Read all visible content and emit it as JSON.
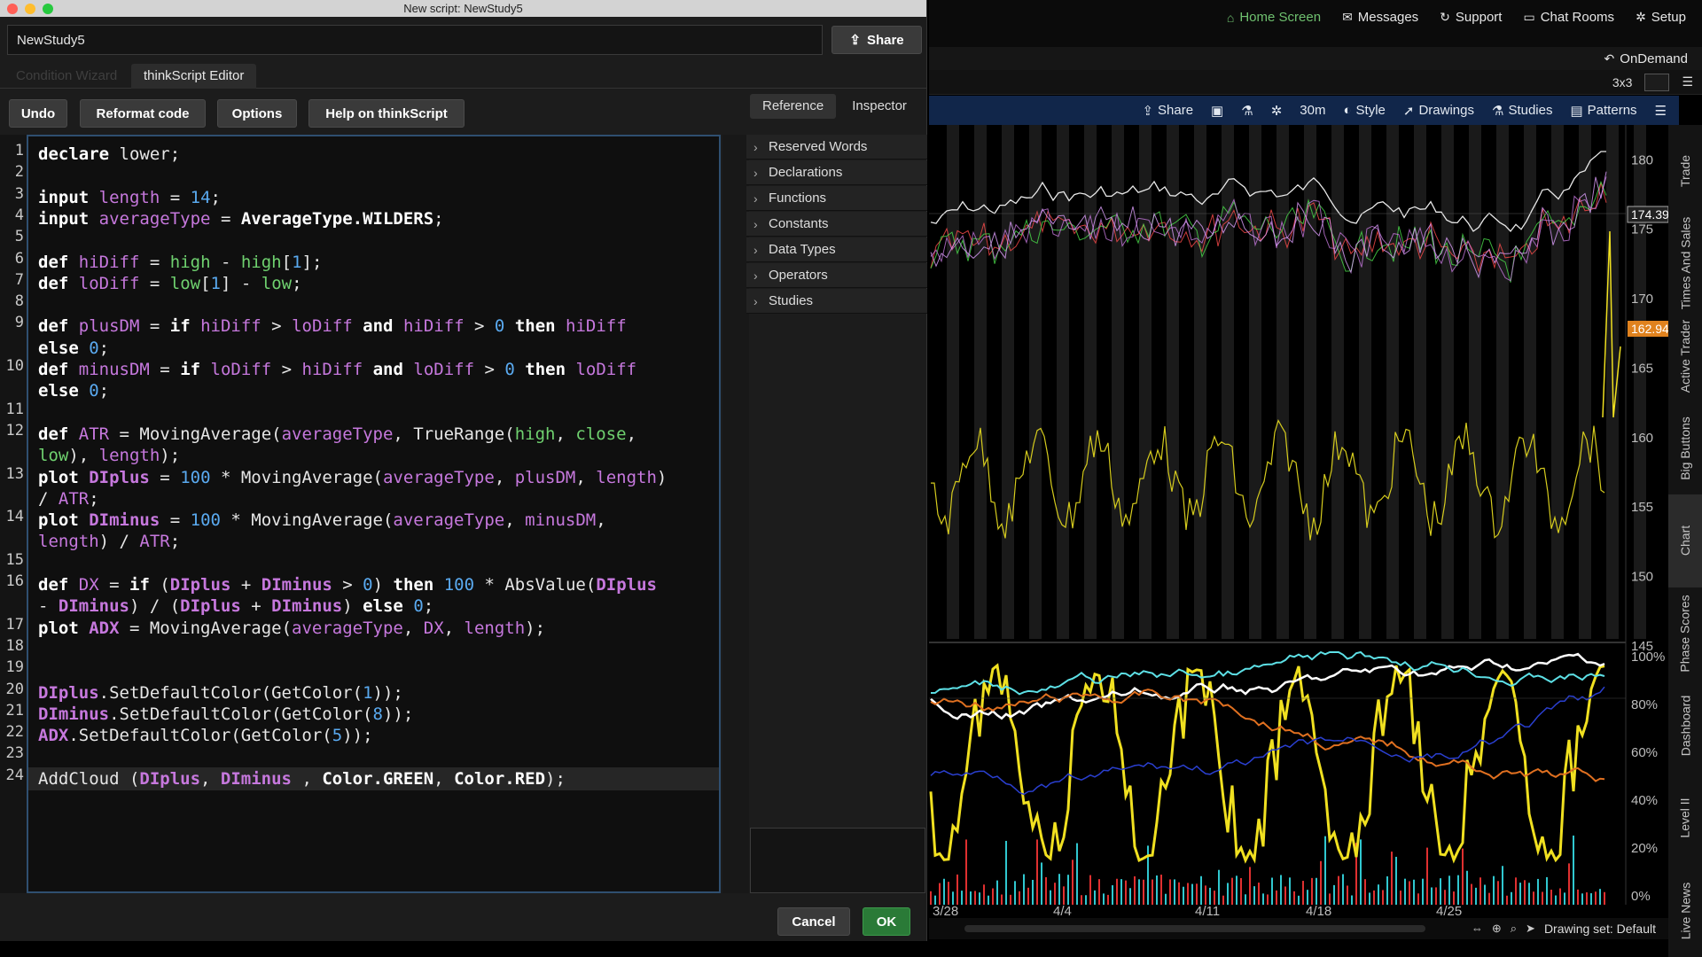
{
  "window_title": "New script: NewStudy5",
  "script_name": "NewStudy5",
  "share_label": "Share",
  "tabs": [
    "Condition Wizard",
    "thinkScript Editor"
  ],
  "buttons": {
    "undo": "Undo",
    "reformat": "Reformat code",
    "options": "Options",
    "help": "Help on thinkScript"
  },
  "ref_tabs": [
    "Reference",
    "Inspector"
  ],
  "reference_items": [
    "Reserved Words",
    "Declarations",
    "Functions",
    "Constants",
    "Data Types",
    "Operators",
    "Studies"
  ],
  "dialog_buttons": {
    "cancel": "Cancel",
    "ok": "OK"
  },
  "code_lines": [
    [
      [
        [
          "kw",
          "declare"
        ],
        [
          "fn",
          " lower;"
        ]
      ]
    ],
    [],
    [
      [
        [
          "kw",
          "input"
        ],
        [
          "fn",
          " "
        ],
        [
          "vr",
          "length"
        ],
        [
          "fn",
          " = "
        ],
        [
          "nm",
          "14"
        ],
        [
          "fn",
          ";"
        ]
      ]
    ],
    [
      [
        [
          "kw",
          "input"
        ],
        [
          "fn",
          " "
        ],
        [
          "vr",
          "averageType"
        ],
        [
          "fn",
          " = "
        ],
        [
          "kw",
          "AverageType.WILDERS"
        ],
        [
          "fn",
          ";"
        ]
      ]
    ],
    [],
    [
      [
        [
          "kw",
          "def"
        ],
        [
          "fn",
          " "
        ],
        [
          "vr",
          "hiDiff"
        ],
        [
          "fn",
          " = "
        ],
        [
          "gr",
          "high"
        ],
        [
          "fn",
          " - "
        ],
        [
          "gr",
          "high"
        ],
        [
          "fn",
          "["
        ],
        [
          "nm",
          "1"
        ],
        [
          "fn",
          "];"
        ]
      ]
    ],
    [
      [
        [
          "kw",
          "def"
        ],
        [
          "fn",
          " "
        ],
        [
          "vr",
          "loDiff"
        ],
        [
          "fn",
          " = "
        ],
        [
          "gr",
          "low"
        ],
        [
          "fn",
          "["
        ],
        [
          "nm",
          "1"
        ],
        [
          "fn",
          "] - "
        ],
        [
          "gr",
          "low"
        ],
        [
          "fn",
          ";"
        ]
      ]
    ],
    [],
    [
      [
        [
          "kw",
          "def"
        ],
        [
          "fn",
          " "
        ],
        [
          "vr",
          "plusDM"
        ],
        [
          "fn",
          " = "
        ],
        [
          "kw",
          "if"
        ],
        [
          "fn",
          " "
        ],
        [
          "vr",
          "hiDiff"
        ],
        [
          "fn",
          " > "
        ],
        [
          "vr",
          "loDiff"
        ],
        [
          "fn",
          " "
        ],
        [
          "kw",
          "and"
        ],
        [
          "fn",
          " "
        ],
        [
          "vr",
          "hiDiff"
        ],
        [
          "fn",
          " > "
        ],
        [
          "nm",
          "0"
        ],
        [
          "fn",
          " "
        ],
        [
          "kw",
          "then"
        ],
        [
          "fn",
          " "
        ],
        [
          "vr",
          "hiDiff"
        ]
      ],
      [
        [
          "kw",
          "else"
        ],
        [
          "fn",
          " "
        ],
        [
          "nm",
          "0"
        ],
        [
          "fn",
          ";"
        ]
      ]
    ],
    [
      [
        [
          "kw",
          "def"
        ],
        [
          "fn",
          " "
        ],
        [
          "vr",
          "minusDM"
        ],
        [
          "fn",
          " = "
        ],
        [
          "kw",
          "if"
        ],
        [
          "fn",
          " "
        ],
        [
          "vr",
          "loDiff"
        ],
        [
          "fn",
          " > "
        ],
        [
          "vr",
          "hiDiff"
        ],
        [
          "fn",
          " "
        ],
        [
          "kw",
          "and"
        ],
        [
          "fn",
          " "
        ],
        [
          "vr",
          "loDiff"
        ],
        [
          "fn",
          " > "
        ],
        [
          "nm",
          "0"
        ],
        [
          "fn",
          " "
        ],
        [
          "kw",
          "then"
        ],
        [
          "fn",
          " "
        ],
        [
          "vr",
          "loDiff"
        ]
      ],
      [
        [
          "kw",
          "else"
        ],
        [
          "fn",
          " "
        ],
        [
          "nm",
          "0"
        ],
        [
          "fn",
          ";"
        ]
      ]
    ],
    [],
    [
      [
        [
          "kw",
          "def"
        ],
        [
          "fn",
          " "
        ],
        [
          "vr",
          "ATR"
        ],
        [
          "fn",
          " = MovingAverage("
        ],
        [
          "vr",
          "averageType"
        ],
        [
          "fn",
          ", TrueRange("
        ],
        [
          "gr",
          "high"
        ],
        [
          "fn",
          ", "
        ],
        [
          "gr",
          "close"
        ],
        [
          "fn",
          ","
        ]
      ],
      [
        [
          "gr",
          "low"
        ],
        [
          "fn",
          "), "
        ],
        [
          "vr",
          "length"
        ],
        [
          "fn",
          ");"
        ]
      ]
    ],
    [
      [
        [
          "kw",
          "plot"
        ],
        [
          "fn",
          " "
        ],
        [
          "vb",
          "DIplus"
        ],
        [
          "fn",
          " = "
        ],
        [
          "nm",
          "100"
        ],
        [
          "fn",
          " * MovingAverage("
        ],
        [
          "vr",
          "averageType"
        ],
        [
          "fn",
          ", "
        ],
        [
          "vr",
          "plusDM"
        ],
        [
          "fn",
          ", "
        ],
        [
          "vr",
          "length"
        ],
        [
          "fn",
          ")"
        ]
      ],
      [
        [
          "fn",
          "/ "
        ],
        [
          "vr",
          "ATR"
        ],
        [
          "fn",
          ";"
        ]
      ]
    ],
    [
      [
        [
          "kw",
          "plot"
        ],
        [
          "fn",
          " "
        ],
        [
          "vb",
          "DIminus"
        ],
        [
          "fn",
          " = "
        ],
        [
          "nm",
          "100"
        ],
        [
          "fn",
          " * MovingAverage("
        ],
        [
          "vr",
          "averageType"
        ],
        [
          "fn",
          ", "
        ],
        [
          "vr",
          "minusDM"
        ],
        [
          "fn",
          ","
        ]
      ],
      [
        [
          "vr",
          "length"
        ],
        [
          "fn",
          ") / "
        ],
        [
          "vr",
          "ATR"
        ],
        [
          "fn",
          ";"
        ]
      ]
    ],
    [],
    [
      [
        [
          "kw",
          "def"
        ],
        [
          "fn",
          " "
        ],
        [
          "vr",
          "DX"
        ],
        [
          "fn",
          " = "
        ],
        [
          "kw",
          "if"
        ],
        [
          "fn",
          " ("
        ],
        [
          "vb",
          "DIplus"
        ],
        [
          "fn",
          " + "
        ],
        [
          "vb",
          "DIminus"
        ],
        [
          "fn",
          " > "
        ],
        [
          "nm",
          "0"
        ],
        [
          "fn",
          ") "
        ],
        [
          "kw",
          "then"
        ],
        [
          "fn",
          " "
        ],
        [
          "nm",
          "100"
        ],
        [
          "fn",
          " * AbsValue("
        ],
        [
          "vb",
          "DIplus"
        ]
      ],
      [
        [
          "fn",
          "- "
        ],
        [
          "vb",
          "DIminus"
        ],
        [
          "fn",
          ") / ("
        ],
        [
          "vb",
          "DIplus"
        ],
        [
          "fn",
          " + "
        ],
        [
          "vb",
          "DIminus"
        ],
        [
          "fn",
          ") "
        ],
        [
          "kw",
          "else"
        ],
        [
          "fn",
          " "
        ],
        [
          "nm",
          "0"
        ],
        [
          "fn",
          ";"
        ]
      ]
    ],
    [
      [
        [
          "kw",
          "plot"
        ],
        [
          "fn",
          " "
        ],
        [
          "vb",
          "ADX"
        ],
        [
          "fn",
          " = MovingAverage("
        ],
        [
          "vr",
          "averageType"
        ],
        [
          "fn",
          ", "
        ],
        [
          "vr",
          "DX"
        ],
        [
          "fn",
          ", "
        ],
        [
          "vr",
          "length"
        ],
        [
          "fn",
          ");"
        ]
      ]
    ],
    [],
    [],
    [
      [
        [
          "vb",
          "DIplus"
        ],
        [
          "fn",
          ".SetDefaultColor(GetColor("
        ],
        [
          "nm",
          "1"
        ],
        [
          "fn",
          "));"
        ]
      ]
    ],
    [
      [
        [
          "vb",
          "DIminus"
        ],
        [
          "fn",
          ".SetDefaultColor(GetColor("
        ],
        [
          "nm",
          "8"
        ],
        [
          "fn",
          "));"
        ]
      ]
    ],
    [
      [
        [
          "vb",
          "ADX"
        ],
        [
          "fn",
          ".SetDefaultColor(GetColor("
        ],
        [
          "nm",
          "5"
        ],
        [
          "fn",
          "));"
        ]
      ]
    ],
    [],
    [
      [
        [
          "fn",
          "AddCloud ("
        ],
        [
          "vb",
          "DIplus"
        ],
        [
          "fn",
          ", "
        ],
        [
          "vb",
          "DIminus"
        ],
        [
          "fn",
          " , "
        ],
        [
          "kw",
          "Color.GREEN"
        ],
        [
          "fn",
          ", "
        ],
        [
          "kw",
          "Color.RED"
        ],
        [
          "fn",
          ");"
        ]
      ]
    ]
  ],
  "top_nav": [
    {
      "icon": "home-icon",
      "label": "Home Screen"
    },
    {
      "icon": "mail-icon",
      "label": "Messages"
    },
    {
      "icon": "support-icon",
      "label": "Support"
    },
    {
      "icon": "chat-icon",
      "label": "Chat Rooms"
    },
    {
      "icon": "gear-icon",
      "label": "Setup"
    }
  ],
  "ondemand_label": "OnDemand",
  "grid_label": "3x3",
  "chart_toolbar": {
    "share": "Share",
    "timeframe": "30m",
    "style": "Style",
    "drawings": "Drawings",
    "studies": "Studies",
    "patterns": "Patterns"
  },
  "side_tabs": [
    "Trade",
    "Times And Sales",
    "Active Trader",
    "Big Buttons",
    "Chart",
    "Phase Scores",
    "Dashboard",
    "Level II",
    "Live News"
  ],
  "status": {
    "drawing_set": "Drawing set: Default"
  },
  "colors": {
    "ok_green": "#2a7a37",
    "toolbar_blue": "#11264a",
    "price_tag": "#e0821e",
    "editor_border": "#2f4f70"
  },
  "chart_data": [
    {
      "type": "line",
      "panel": "price",
      "ytick_labels": [
        "180",
        "175",
        "170",
        "165",
        "160",
        "155",
        "150",
        "145"
      ],
      "ylim": [
        145,
        182
      ],
      "price_labels": {
        "last": "174.39",
        "current": "162.94"
      },
      "series": []
    },
    {
      "type": "line",
      "panel": "indicator",
      "ytick_labels": [
        "100%",
        "80%",
        "60%",
        "40%",
        "20%",
        "0%"
      ],
      "ylim": [
        0,
        100
      ],
      "series": []
    },
    {
      "type": "line",
      "panel": "x_axis",
      "xtick_labels": [
        "3/28",
        "4/4",
        "4/11",
        "4/18",
        "4/25"
      ]
    }
  ]
}
